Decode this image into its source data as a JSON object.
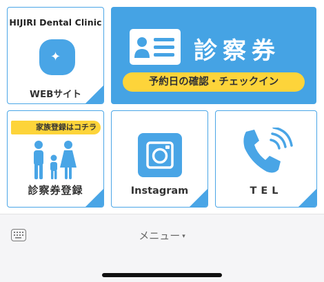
{
  "tiles": {
    "web": {
      "clinic_name": "HIJIRI Dental Clinic",
      "label": "WEBサイト",
      "icon": "sparkle-icon"
    },
    "card": {
      "title": "診察券",
      "subtitle": "予約日の確認・チェックイン",
      "icon": "id-card-icon"
    },
    "register": {
      "badge": "家族登録はコチラ",
      "label": "診察券登録",
      "icon": "family-icon"
    },
    "instagram": {
      "label": "Instagram",
      "icon": "instagram-icon"
    },
    "tel": {
      "label": "TEL",
      "icon": "phone-icon"
    }
  },
  "bottom_bar": {
    "menu_label": "メニュー",
    "caret": "▾",
    "keyboard_icon": "keyboard-icon"
  },
  "colors": {
    "accent_blue": "#49a5e6",
    "accent_yellow": "#fdd43a"
  }
}
